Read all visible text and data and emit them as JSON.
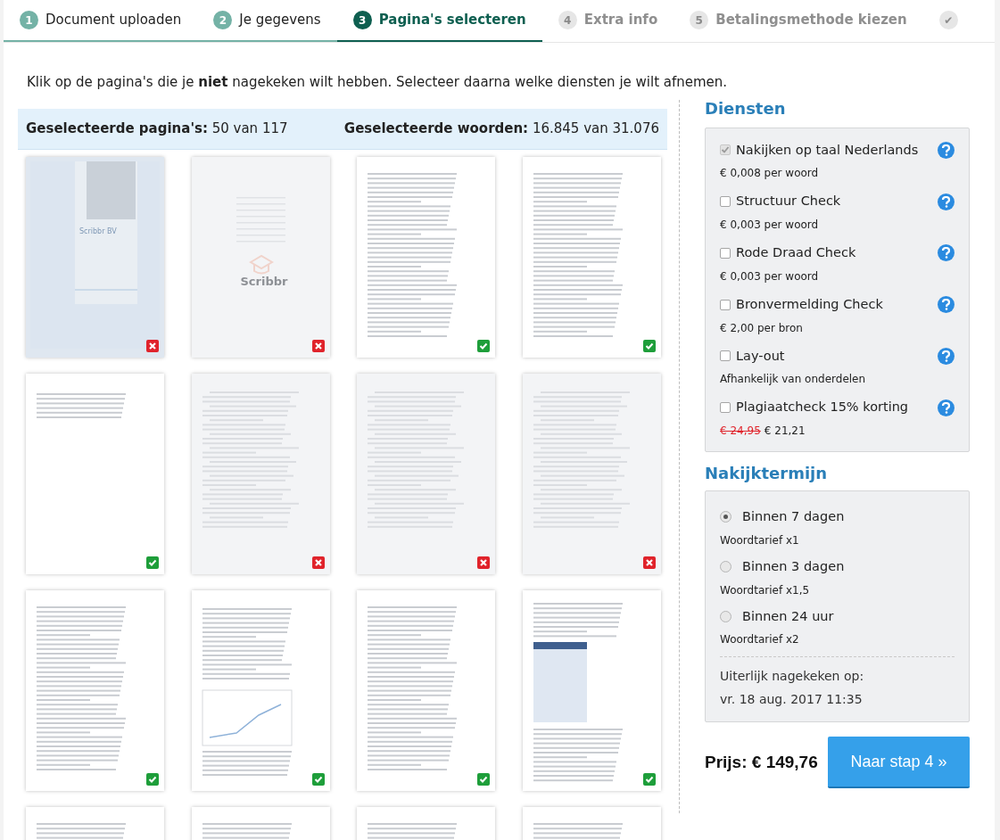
{
  "steps": [
    {
      "number": "1",
      "label": "Document uploaden",
      "selected": false,
      "disabled": false
    },
    {
      "number": "2",
      "label": "Je gegevens",
      "selected": false,
      "disabled": false
    },
    {
      "number": "3",
      "label": "Pagina's selecteren",
      "selected": true,
      "disabled": false
    },
    {
      "number": "4",
      "label": "Extra info",
      "selected": false,
      "disabled": true
    },
    {
      "number": "5",
      "label": "Betalingsmethode kiezen",
      "selected": false,
      "disabled": true
    },
    {
      "number": "✔",
      "selected": false,
      "disabled": true
    }
  ],
  "instruction": "Klik op de pagina's die je **niet** nagekeken wilt hebben. Selecteer daarna welke diensten je wilt afnemen.",
  "summary": {
    "pages_label": "Geselecteerde pagina's:",
    "pages_value": "50 van 117",
    "words_label": "Geselecteerde woorden:",
    "words_value": "16.845 van 31.076"
  },
  "pages": [
    {
      "kind": "cover",
      "selected": false,
      "title": "Scribbr BV"
    },
    {
      "kind": "titlepage",
      "selected": false,
      "title": "Scribbr"
    },
    {
      "kind": "text",
      "selected": true
    },
    {
      "kind": "text",
      "selected": true
    },
    {
      "kind": "short",
      "selected": true
    },
    {
      "kind": "toc",
      "selected": false
    },
    {
      "kind": "toc",
      "selected": false
    },
    {
      "kind": "toc",
      "selected": false
    },
    {
      "kind": "text",
      "selected": true
    },
    {
      "kind": "chart",
      "selected": true
    },
    {
      "kind": "text",
      "selected": true
    },
    {
      "kind": "table",
      "selected": true
    },
    {
      "kind": "text"
    },
    {
      "kind": "text"
    },
    {
      "kind": "text"
    },
    {
      "kind": "text"
    }
  ],
  "services": {
    "title": "Diensten",
    "items": [
      {
        "label": "Nakijken op taal Nederlands",
        "checked": true,
        "disabled": true,
        "price": "€ 0,008 per woord"
      },
      {
        "label": "Structuur Check",
        "checked": false,
        "disabled": false,
        "price": "€ 0,003 per woord"
      },
      {
        "label": "Rode Draad Check",
        "checked": false,
        "disabled": false,
        "price": "€ 0,003 per woord"
      },
      {
        "label": "Bronvermelding Check",
        "checked": false,
        "disabled": false,
        "price": "€ 2,00 per bron"
      },
      {
        "label": "Lay-out",
        "checked": false,
        "disabled": false,
        "price": "Afhankelijk van onderdelen"
      },
      {
        "label": "Plagiaatcheck 15% korting",
        "checked": false,
        "disabled": false,
        "old_price": "€ 24,95",
        "price": "€ 21,21"
      }
    ]
  },
  "term": {
    "title": "Nakijktermijn",
    "options": [
      {
        "label": "Binnen 7 dagen",
        "rate": "Woordtarief x1",
        "selected": true
      },
      {
        "label": "Binnen 3 dagen",
        "rate": "Woordtarief x1,5",
        "selected": false
      },
      {
        "label": "Binnen 24 uur",
        "rate": "Woordtarief x2",
        "selected": false
      }
    ],
    "deadline_label": "Uiterlijk nagekeken op:",
    "deadline": "vr. 18 aug. 2017 11:35"
  },
  "price": "Prijs: € 149,76",
  "next_button": "Naar stap 4 »"
}
